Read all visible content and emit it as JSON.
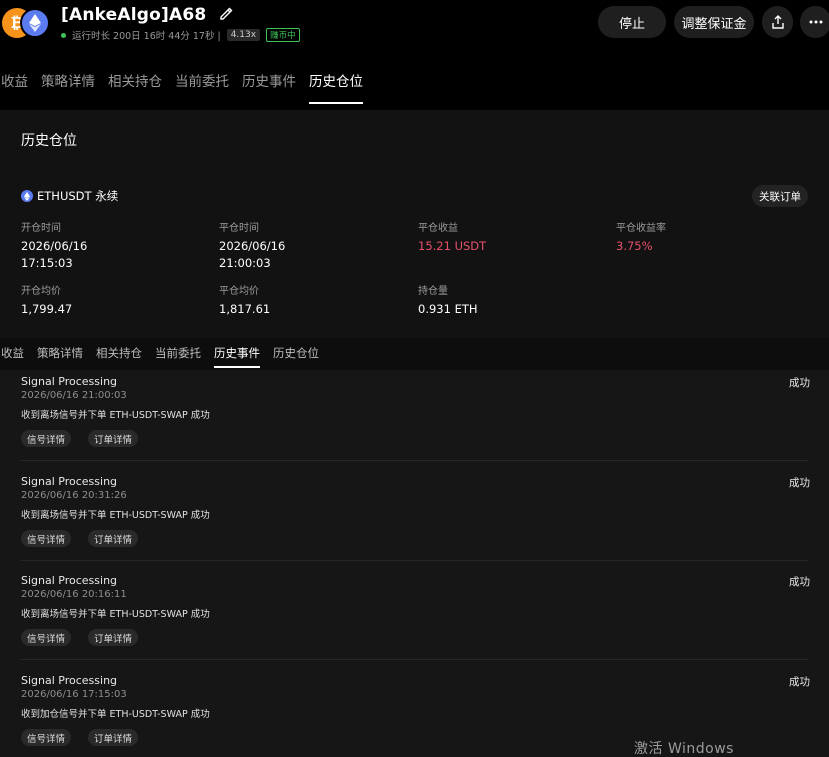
{
  "header": {
    "title": "[AnkeAlgo]A68",
    "runtime": "运行时长 200日 16时 44分 17秒 |",
    "leverage": "4.13x",
    "state": "赚币中",
    "stop_label": "停止",
    "margin_label": "调整保证金",
    "btc_glyph": "₿"
  },
  "tabs": [
    "收益",
    "策略详情",
    "相关持仓",
    "当前委托",
    "历史事件",
    "历史仓位"
  ],
  "active_tab": 5,
  "panel": {
    "title": "历史仓位",
    "symbol": "ETHUSDT 永续",
    "related_label": "关联订单",
    "open_time_label": "开仓时间",
    "open_date": "2026/06/16",
    "open_clock": "17:15:03",
    "close_time_label": "平仓时间",
    "close_date": "2026/06/16",
    "close_clock": "21:00:03",
    "pnl_label": "平仓收益",
    "pnl_value": "15.21 USDT",
    "pnl_rate_label": "平仓收益率",
    "pnl_rate_value": "3.75%",
    "open_avg_label": "开仓均价",
    "open_avg_value": "1,799.47",
    "close_avg_label": "平仓均价",
    "close_avg_value": "1,817.61",
    "position_label": "持仓量",
    "position_value": "0.931 ETH",
    "pnl_color": "#e8506a"
  },
  "subtabs": [
    "收益",
    "策略详情",
    "相关持仓",
    "当前委托",
    "历史事件",
    "历史仓位"
  ],
  "active_subtab": 4,
  "events": [
    {
      "title": "Signal Processing",
      "status": "成功",
      "time": "2026/06/16 21:00:03",
      "message": "收到离场信号并下单 ETH-USDT-SWAP 成功",
      "btn1": "信号详情",
      "btn2": "订单详情"
    },
    {
      "title": "Signal Processing",
      "status": "成功",
      "time": "2026/06/16 20:31:26",
      "message": "收到离场信号并下单 ETH-USDT-SWAP 成功",
      "btn1": "信号详情",
      "btn2": "订单详情"
    },
    {
      "title": "Signal Processing",
      "status": "成功",
      "time": "2026/06/16 20:16:11",
      "message": "收到离场信号并下单 ETH-USDT-SWAP 成功",
      "btn1": "信号详情",
      "btn2": "订单详情"
    },
    {
      "title": "Signal Processing",
      "status": "成功",
      "time": "2026/06/16 17:15:03",
      "message": "收到加仓信号并下单 ETH-USDT-SWAP 成功",
      "btn1": "信号详情",
      "btn2": "订单详情"
    }
  ],
  "watermark": "激活 Windows"
}
